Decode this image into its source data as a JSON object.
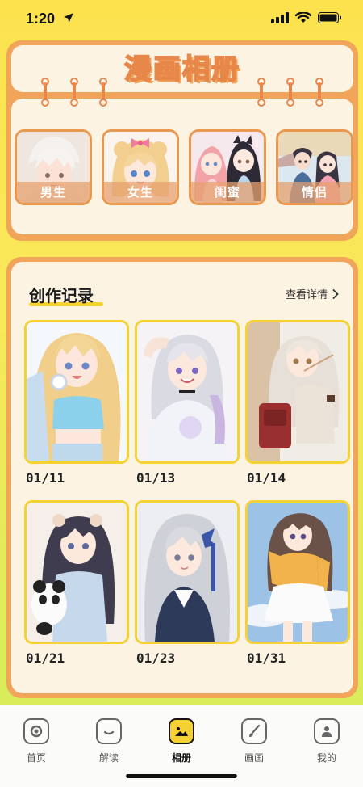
{
  "status": {
    "time": "1:20"
  },
  "album": {
    "title": "漫画相册",
    "categories": [
      {
        "label": "男生",
        "icon": "boy-portrait"
      },
      {
        "label": "女生",
        "icon": "girl-portrait"
      },
      {
        "label": "闺蜜",
        "icon": "besties-portrait"
      },
      {
        "label": "情侣",
        "icon": "couple-portrait"
      }
    ]
  },
  "records": {
    "title": "创作记录",
    "details_label": "查看详情",
    "items": [
      {
        "date": "01/11"
      },
      {
        "date": "01/13"
      },
      {
        "date": "01/14"
      },
      {
        "date": "01/21"
      },
      {
        "date": "01/23"
      },
      {
        "date": "01/31"
      }
    ]
  },
  "nav": {
    "items": [
      {
        "label": "首页",
        "icon": "home-icon"
      },
      {
        "label": "解读",
        "icon": "read-icon"
      },
      {
        "label": "相册",
        "icon": "album-icon",
        "active": true
      },
      {
        "label": "画画",
        "icon": "brush-icon"
      },
      {
        "label": "我的",
        "icon": "profile-icon"
      }
    ]
  },
  "colors": {
    "accent": "#f5d232",
    "frame": "#f0a55a",
    "card": "#fdf3e3"
  }
}
